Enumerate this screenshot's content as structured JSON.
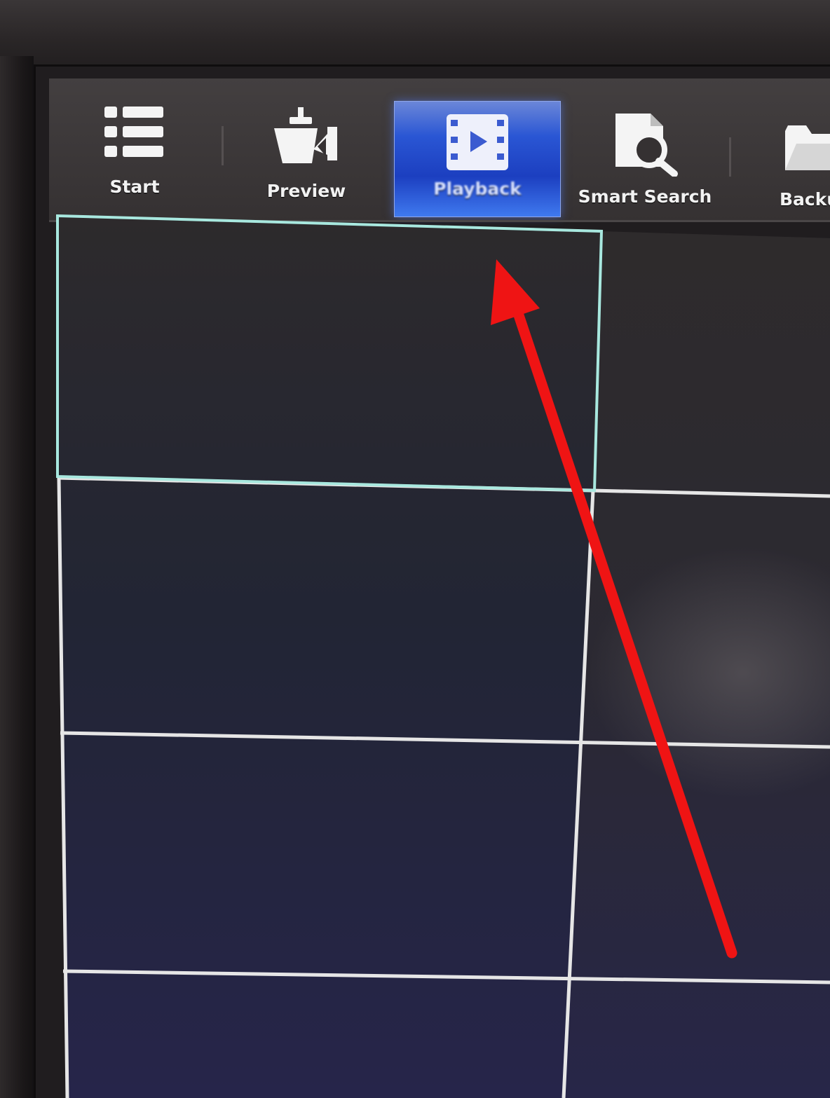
{
  "menu": {
    "items": [
      {
        "label": "Start",
        "icon": "list-icon",
        "active": false
      },
      {
        "label": "Preview",
        "icon": "camera-icon",
        "active": false
      },
      {
        "label": "Playback",
        "icon": "film-play-icon",
        "active": true
      },
      {
        "label": "Smart Search",
        "icon": "document-search-icon",
        "active": false
      },
      {
        "label": "Backu",
        "icon": "folder-icon",
        "active": false
      }
    ]
  },
  "channel_grid": {
    "rows": 4,
    "columns": 2,
    "selected_channel": 1
  },
  "colors": {
    "active_tab": "#2a56d4",
    "selected_cell_border": "#a8e8df",
    "grid_lines": "#e6e6e6",
    "annotation_arrow": "#ef1414"
  }
}
